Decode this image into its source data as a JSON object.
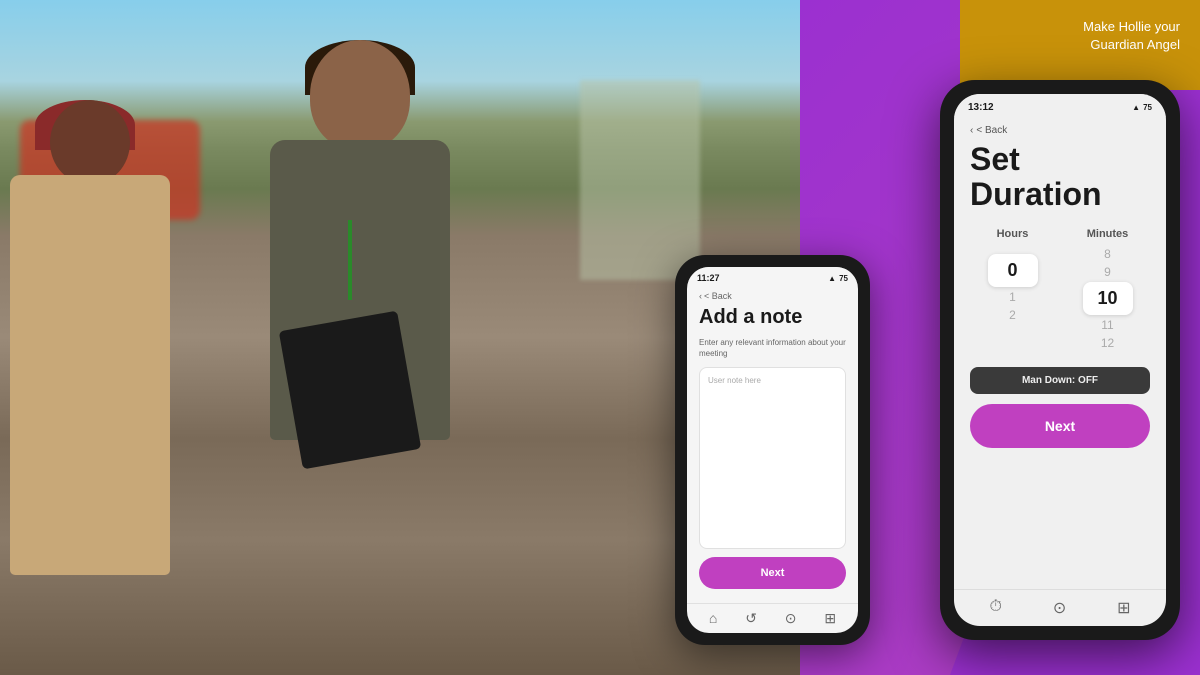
{
  "tagline": {
    "line1": "Make Hollie your",
    "line2": "Guardian Angel"
  },
  "phone1": {
    "status_time": "11:27",
    "status_icons": "● ▲ 75",
    "back_label": "< Back",
    "title": "Add a note",
    "description": "Enter any relevant information about your meeting",
    "textarea_placeholder": "User note here",
    "next_button": "Next",
    "nav_icons": [
      "⌂",
      "↺",
      "⊙",
      "⊞"
    ]
  },
  "phone2": {
    "status_time": "13:12",
    "status_icons": "● ▲ 75",
    "back_label": "< Back",
    "title_line1": "Set",
    "title_line2": "Duration",
    "hours_label": "Hours",
    "minutes_label": "Minutes",
    "hours_scroll": [
      "",
      "",
      "0",
      "1",
      "2"
    ],
    "minutes_scroll": [
      "8",
      "9",
      "10",
      "11",
      "12"
    ],
    "hours_selected": "0",
    "minutes_selected": "10",
    "man_down": "Man Down: OFF",
    "next_button": "Next",
    "nav_icons": [
      "⏱",
      "⊙",
      "⊞"
    ]
  },
  "colors": {
    "purple": "#c040c0",
    "gold": "#c8920a",
    "dark": "#1a1a1a",
    "light_bg": "#f0f0f0"
  }
}
